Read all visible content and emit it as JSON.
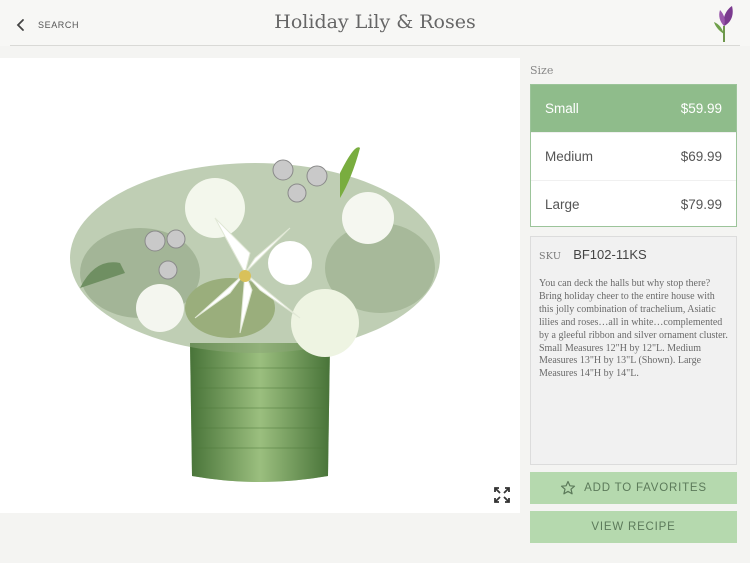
{
  "header": {
    "back_label": "SEARCH",
    "title": "Holiday Lily & Roses"
  },
  "size": {
    "label": "Size",
    "options": [
      {
        "name": "Small",
        "price": "$59.99",
        "selected": true
      },
      {
        "name": "Medium",
        "price": "$69.99",
        "selected": false
      },
      {
        "name": "Large",
        "price": "$79.99",
        "selected": false
      }
    ]
  },
  "product": {
    "sku_label": "SKU",
    "sku": "BF102-11KS",
    "description": "You can deck the halls but why stop there? Bring holiday cheer to the entire house with this jolly combination of trachelium, Asiatic lilies and roses…all in white…complemented by a gleeful ribbon and silver ornament cluster. Small Measures 12\"H by 12\"L. Medium Measures 13\"H by 13\"L (Shown). Large Measures 14\"H by 14\"L."
  },
  "actions": {
    "favorites_label": "ADD TO FAVORITES",
    "recipe_label": "VIEW RECIPE"
  },
  "icons": {
    "back": "chevron-left-icon",
    "logo": "tulip-logo-icon",
    "expand": "expand-icon",
    "favorites": "star-icon"
  },
  "colors": {
    "selected_size": "#8fbc8b",
    "button_bg": "#b5d9ae",
    "logo_purple": "#7b3a8f"
  }
}
